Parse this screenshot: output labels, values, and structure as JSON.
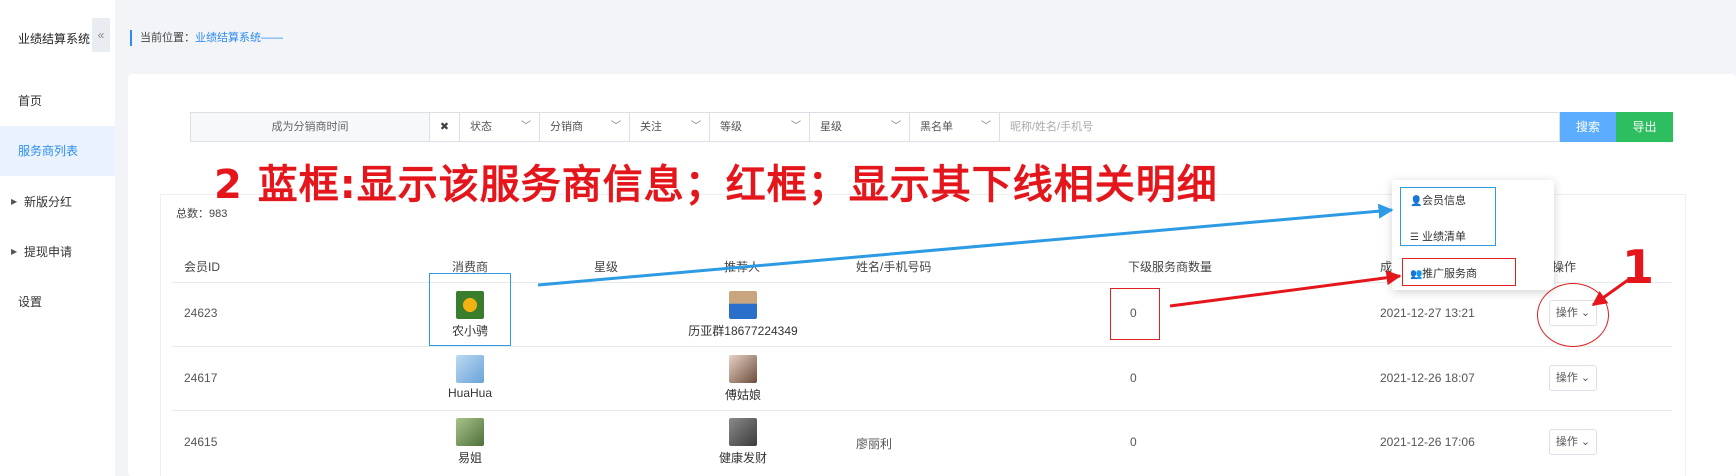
{
  "sidebar": {
    "logo": "业绩结算系统",
    "collapse": "«",
    "items": [
      {
        "label": "首页"
      },
      {
        "label": "服务商列表"
      },
      {
        "label": "新版分红"
      },
      {
        "label": "提现申请"
      },
      {
        "label": "设置"
      }
    ]
  },
  "breadcrumb": {
    "prefix": "当前位置：",
    "current": "业绩结算系统——"
  },
  "filters": {
    "date_label": "成为分销商时间",
    "clear": "✖",
    "selects": [
      "状态",
      "分销商",
      "关注",
      "等级",
      "星级",
      "黑名单"
    ],
    "search_placeholder": "昵称/姓名/手机号",
    "search_btn": "搜索",
    "export_btn": "导出"
  },
  "table": {
    "total": "总数：983",
    "headers": [
      "会员ID",
      "消费商",
      "星级",
      "推荐人",
      "姓名/手机号码",
      "下级服务商数量",
      "成",
      "操作"
    ],
    "rows": [
      {
        "id": "24623",
        "consumer": "农小骋",
        "referrer": "历亚群18677224349",
        "name_phone": "",
        "sub_count": "0",
        "time": "2021-12-27 13:21",
        "op": "操作"
      },
      {
        "id": "24617",
        "consumer": "HuaHua",
        "referrer": "傅姑娘",
        "name_phone": "",
        "sub_count": "0",
        "time": "2021-12-26 18:07",
        "op": "操作"
      },
      {
        "id": "24615",
        "consumer": "易姐",
        "referrer": "健康发财",
        "name_phone": "廖丽利",
        "sub_count": "0",
        "time": "2021-12-26 17:06",
        "op": "操作"
      }
    ]
  },
  "dropdown": {
    "items": [
      {
        "label": "会员信息",
        "icon": "user-icon"
      },
      {
        "label": "业绩清单",
        "icon": "list-icon"
      },
      {
        "label": "推广服务商",
        "icon": "users-icon"
      }
    ]
  },
  "annotation": {
    "title": "2 蓝框:显示该服务商信息；红框；显示其下线相关明细",
    "step": "1"
  },
  "colors": {
    "accent": "#2d8cf0",
    "annotation_red": "#e4161c",
    "annotation_blue": "#2d9be3",
    "export": "#2dbe60"
  }
}
